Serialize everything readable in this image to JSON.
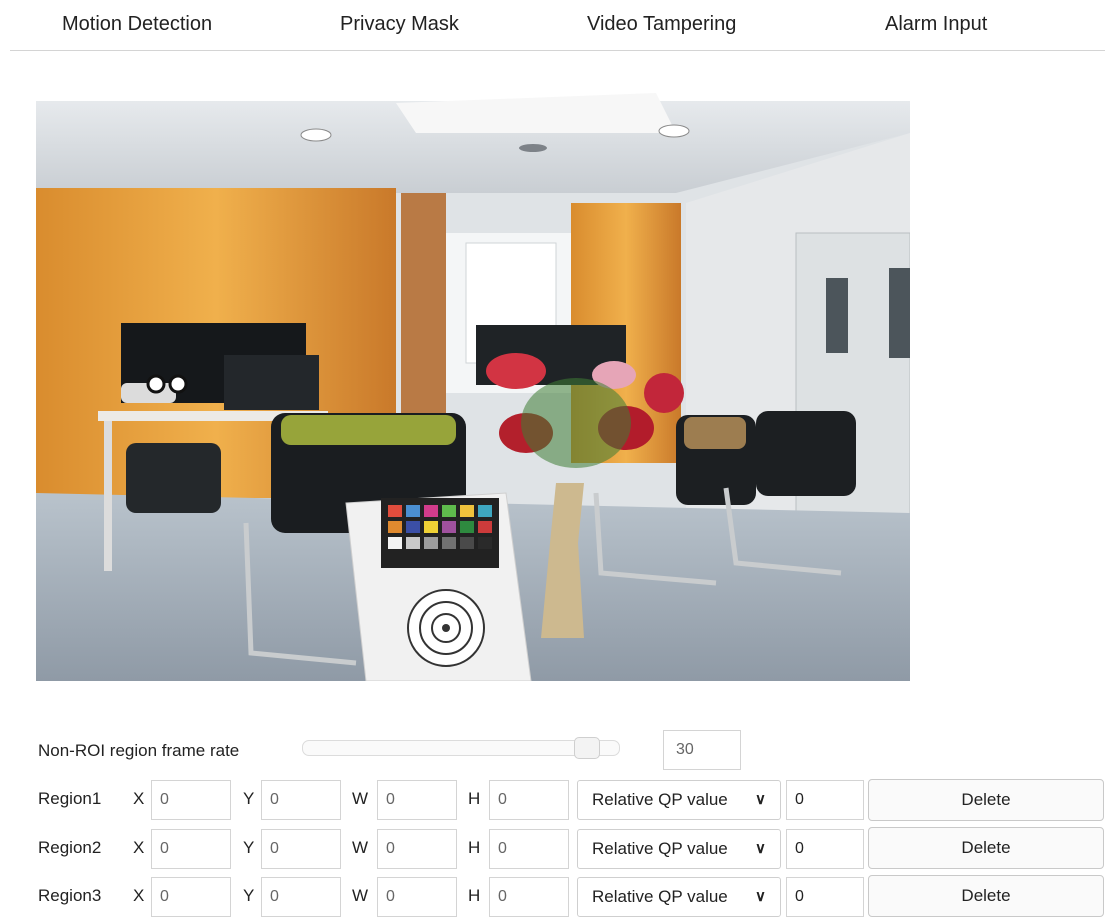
{
  "tabs": [
    "Motion Detection",
    "Privacy Mask",
    "Video Tampering",
    "Alarm Input"
  ],
  "preview": {
    "description_icon": "camera-live-view"
  },
  "non_roi": {
    "label": "Non-ROI region frame rate",
    "value": "30",
    "slider_fraction": 0.93
  },
  "regions": [
    {
      "name": "Region1",
      "x": "0",
      "y": "0",
      "w": "0",
      "h": "0",
      "qp_mode": "Relative QP value",
      "qp": "0",
      "delete_label": "Delete"
    },
    {
      "name": "Region2",
      "x": "0",
      "y": "0",
      "w": "0",
      "h": "0",
      "qp_mode": "Relative QP value",
      "qp": "0",
      "delete_label": "Delete"
    },
    {
      "name": "Region3",
      "x": "0",
      "y": "0",
      "w": "0",
      "h": "0",
      "qp_mode": "Relative QP value",
      "qp": "0",
      "delete_label": "Delete"
    }
  ],
  "axis_labels": {
    "x": "X",
    "y": "Y",
    "w": "W",
    "h": "H"
  }
}
